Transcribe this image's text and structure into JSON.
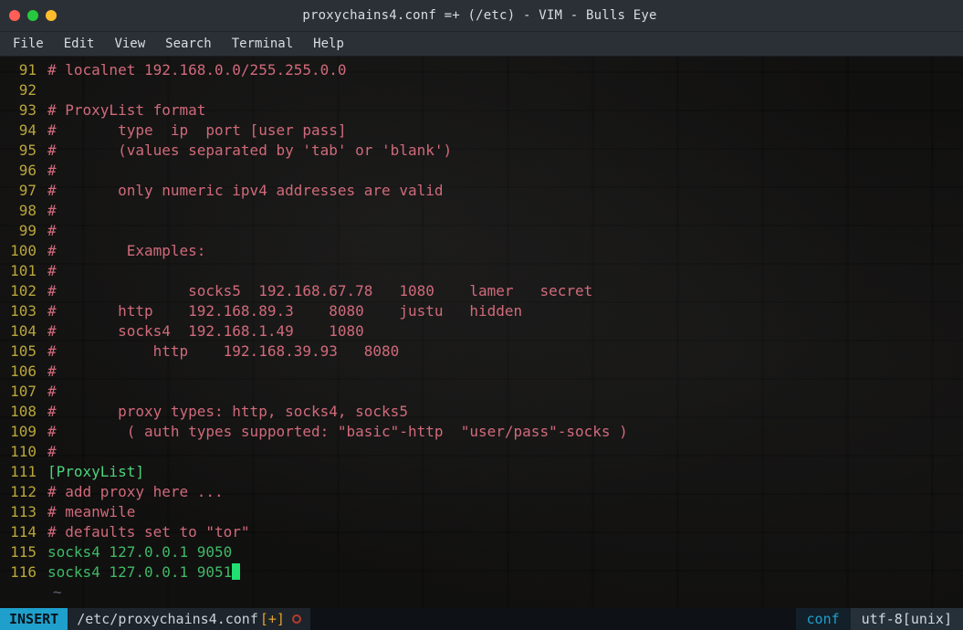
{
  "titlebar": {
    "title": "proxychains4.conf =+ (/etc) - VIM - Bulls Eye"
  },
  "menu": {
    "file": "File",
    "edit": "Edit",
    "view": "View",
    "search": "Search",
    "terminal": "Terminal",
    "help": "Help"
  },
  "gutter": {
    "start": 91,
    "end": 116
  },
  "lines": {
    "l91": {
      "text": "# localnet 192.168.0.0/255.255.0.0",
      "cls": "c-comment"
    },
    "l92": {
      "text": "",
      "cls": ""
    },
    "l93": {
      "text": "# ProxyList format",
      "cls": "c-comment"
    },
    "l94": {
      "text": "#       type  ip  port [user pass]",
      "cls": "c-comment"
    },
    "l95": {
      "text": "#       (values separated by 'tab' or 'blank')",
      "cls": "c-comment"
    },
    "l96": {
      "text": "#",
      "cls": "c-comment"
    },
    "l97": {
      "text": "#       only numeric ipv4 addresses are valid",
      "cls": "c-comment"
    },
    "l98": {
      "text": "#",
      "cls": "c-comment"
    },
    "l99": {
      "text": "#",
      "cls": "c-comment"
    },
    "l100": {
      "text": "#        Examples:",
      "cls": "c-comment"
    },
    "l101": {
      "text": "#",
      "cls": "c-comment"
    },
    "l102": {
      "text": "#               socks5  192.168.67.78   1080    lamer   secret",
      "cls": "c-comment"
    },
    "l103": {
      "text": "#       http    192.168.89.3    8080    justu   hidden",
      "cls": "c-comment"
    },
    "l104": {
      "text": "#       socks4  192.168.1.49    1080",
      "cls": "c-comment"
    },
    "l105": {
      "text": "#           http    192.168.39.93   8080",
      "cls": "c-comment"
    },
    "l106": {
      "text": "#",
      "cls": "c-comment"
    },
    "l107": {
      "text": "#",
      "cls": "c-comment"
    },
    "l108": {
      "text": "#       proxy types: http, socks4, socks5",
      "cls": "c-comment"
    },
    "l109": {
      "text": "#        ( auth types supported: \"basic\"-http  \"user/pass\"-socks )",
      "cls": "c-comment"
    },
    "l110": {
      "text": "#",
      "cls": "c-comment"
    },
    "l111": {
      "text": "[ProxyList]",
      "cls": "c-section"
    },
    "l112": {
      "text": "# add proxy here ...",
      "cls": "c-comment"
    },
    "l113": {
      "text": "# meanwile",
      "cls": "c-comment"
    },
    "l114": {
      "text": "# defaults set to \"tor\"",
      "cls": "c-comment"
    },
    "l115": {
      "text": "socks4 127.0.0.1 9050",
      "cls": "c-entry"
    },
    "l116": {
      "text": "socks4 127.0.0.1 9051",
      "cls": "c-entry"
    }
  },
  "eof_tilde": "~",
  "statusbar": {
    "mode": "INSERT",
    "path": "/etc/proxychains4.conf",
    "modified_suffix": "[+]",
    "filetype": "conf",
    "encoding": "utf-8[unix]"
  }
}
